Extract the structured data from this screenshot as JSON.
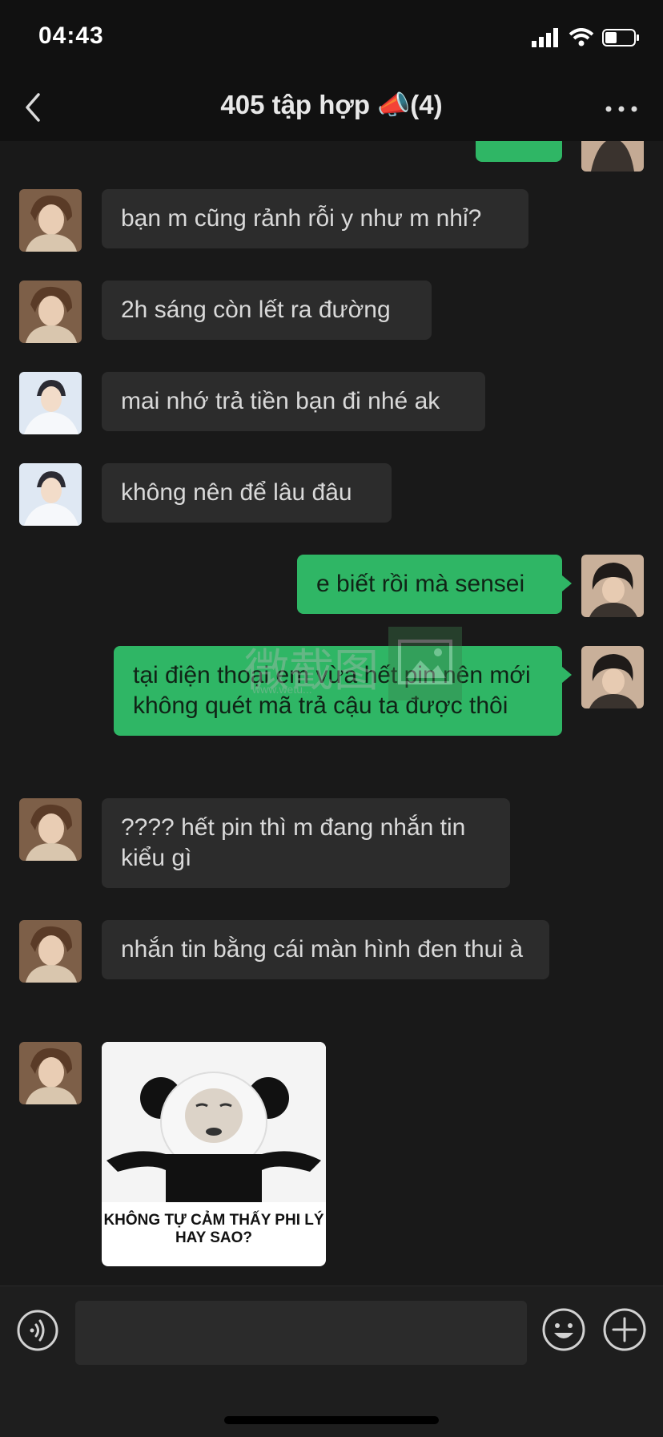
{
  "status_bar": {
    "time": "04:43"
  },
  "header": {
    "title": "405 tập hợp 📣(4)"
  },
  "messages": [
    {
      "text": "bạn m cũng rảnh rỗi y như m nhỉ?"
    },
    {
      "text": "2h sáng còn lết ra đường"
    },
    {
      "text": "mai nhớ trả tiền bạn đi nhé ak"
    },
    {
      "text": "không nên để lâu đâu"
    },
    {
      "text": "e biết rồi mà sensei"
    },
    {
      "text": "tại điện thoại em vừa hết pin nên mới không quét mã trả cậu ta được thôi"
    },
    {
      "text": "???? hết pin thì m đang nhắn tin kiểu gì"
    },
    {
      "text": "nhắn tin bằng cái màn hình đen thui à"
    }
  ],
  "sticker": {
    "caption": "KHÔNG TỰ CẢM THẤY PHI LÝ HAY SAO?"
  },
  "watermark": {
    "text": "微截图",
    "url": "www.wetu..."
  },
  "colors": {
    "outgoing": "#2fb665",
    "incoming": "#2c2c2c",
    "background": "#191919"
  }
}
